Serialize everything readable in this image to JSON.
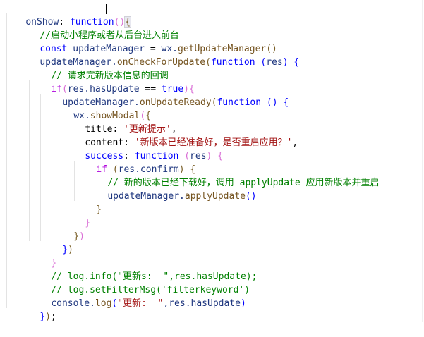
{
  "code": {
    "l1": {
      "name": "onShow",
      "punct": ": ",
      "keyword": "function",
      "paren": "()",
      "brace": "{"
    },
    "l2": {
      "comment": "//启动小程序或者从后台进入前台"
    },
    "l3": {
      "keyword": "const",
      "var": " updateManager ",
      "op": "=",
      "obj": " wx.",
      "method": "getUpdateManager",
      "paren": "()"
    },
    "l4": {
      "obj": "updateManager.",
      "method": "onCheckForUpdate",
      "p1": "(",
      "keyword": "function",
      "sp": " ",
      "p2": "(",
      "param": "res",
      "p3": ")",
      "sp2": " ",
      "brace": "{"
    },
    "l5": {
      "comment": "// 请求完新版本信息的回调"
    },
    "l6": {
      "keyword": "if",
      "p1": "(",
      "expr": "res.hasUpdate ",
      "op": "==",
      "sp": " ",
      "bool": "true",
      "p2": ")",
      "brace": "{"
    },
    "l7": {
      "obj": "updateManager.",
      "method": "onUpdateReady",
      "p1": "(",
      "keyword": "function",
      "sp": " ",
      "p2": "()",
      "sp2": " ",
      "brace": "{"
    },
    "l8": {
      "obj": "wx.",
      "method": "showModal",
      "p1": "(",
      "brace": "{"
    },
    "l9": {
      "key": "title",
      "punct": ": ",
      "string": "'更新提示'",
      "comma": ","
    },
    "l10": {
      "key": "content",
      "punct": ": ",
      "string": "'新版本已经准备好，是否重启应用？'",
      "comma": ","
    },
    "l11": {
      "key": "success",
      "punct": ": ",
      "keyword": "function",
      "sp": " ",
      "p1": "(",
      "param": "res",
      "p2": ")",
      "sp2": " ",
      "brace": "{"
    },
    "l12": {
      "keyword": "if",
      "sp": " ",
      "p1": "(",
      "expr": "res.confirm",
      "p2": ")",
      "sp2": " ",
      "brace": "{"
    },
    "l13": {
      "comment": "// 新的版本已经下载好，调用 applyUpdate 应用新版本并重启"
    },
    "l14": {
      "obj": "updateManager.",
      "method": "applyUpdate",
      "paren": "()"
    },
    "l15": {
      "brace": "}"
    },
    "l16": {
      "brace": "}"
    },
    "l17": {
      "brace": "}",
      "paren": ")"
    },
    "l18": {
      "brace": "}",
      "paren": ")"
    },
    "l19": {
      "brace": "}"
    },
    "l20": {
      "comment": "// log.info(\"更新s:  \",res.hasUpdate);"
    },
    "l21": {
      "comment": "// log.setFilterMsg('filterkeyword')"
    },
    "l22": {
      "obj": "console.",
      "method": "log",
      "p1": "(",
      "string": "\"更新:  \"",
      "rest": ",res.hasUpdate",
      "p2": ")"
    },
    "l23": {
      "brace": "}",
      "paren": ")",
      "semi": ";"
    }
  },
  "colors": {
    "keyword": "#0000ff",
    "identifier": "#1f377f",
    "method": "#74531f",
    "string": "#a31515",
    "comment": "#008000",
    "property": "#000000",
    "bracket_1": "#0000ff",
    "bracket_2": "#da70d6",
    "bracket_3": "#795e26"
  }
}
